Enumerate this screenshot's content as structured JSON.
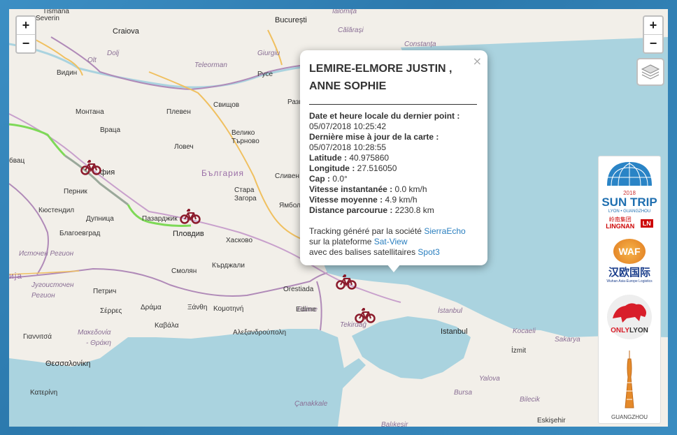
{
  "map": {
    "zoom_in_left": "+",
    "zoom_out_left": "−",
    "zoom_in_right": "+",
    "zoom_out_right": "−",
    "labels": [
      {
        "text": "Tismana",
        "cls": "lbl"
      },
      {
        "text": "Severin",
        "cls": "lbl"
      },
      {
        "text": "Craiova",
        "cls": "lbl city"
      },
      {
        "text": "Dolj",
        "cls": "lbl it"
      },
      {
        "text": "Olt",
        "cls": "lbl it"
      },
      {
        "text": "Teleorman",
        "cls": "lbl it"
      },
      {
        "text": "Ialomița",
        "cls": "lbl it"
      },
      {
        "text": "București",
        "cls": "lbl city"
      },
      {
        "text": "Călărași",
        "cls": "lbl it"
      },
      {
        "text": "Giurgiu",
        "cls": "lbl it"
      },
      {
        "text": "Călărași",
        "cls": "lbl"
      },
      {
        "text": "Constanța",
        "cls": "lbl it"
      },
      {
        "text": "Видин",
        "cls": "lbl"
      },
      {
        "text": "Русе",
        "cls": "lbl"
      },
      {
        "text": "Разгр",
        "cls": "lbl"
      },
      {
        "text": "Монтана",
        "cls": "lbl"
      },
      {
        "text": "Плевен",
        "cls": "lbl"
      },
      {
        "text": "Свищов",
        "cls": "lbl"
      },
      {
        "text": "Враца",
        "cls": "lbl"
      },
      {
        "text": "Велико",
        "cls": "lbl"
      },
      {
        "text": "Търново",
        "cls": "lbl"
      },
      {
        "text": "Ловеч",
        "cls": "lbl"
      },
      {
        "text": "бвац",
        "cls": "lbl"
      },
      {
        "text": "фия",
        "cls": "lbl city"
      },
      {
        "text": "България",
        "cls": "lbl country"
      },
      {
        "text": "Сливен",
        "cls": "lbl"
      },
      {
        "text": "Перник",
        "cls": "lbl"
      },
      {
        "text": "Стара",
        "cls": "lbl"
      },
      {
        "text": "Загора",
        "cls": "lbl"
      },
      {
        "text": "Ямбол",
        "cls": "lbl"
      },
      {
        "text": "Кюстендил",
        "cls": "lbl"
      },
      {
        "text": "Дупница",
        "cls": "lbl"
      },
      {
        "text": "Пазарджик",
        "cls": "lbl"
      },
      {
        "text": "Благоевград",
        "cls": "lbl"
      },
      {
        "text": "Пловдив",
        "cls": "lbl city"
      },
      {
        "text": "Хасково",
        "cls": "lbl"
      },
      {
        "text": "Источен Регион",
        "cls": "lbl it"
      },
      {
        "text": "Смолян",
        "cls": "lbl"
      },
      {
        "text": "Кърджали",
        "cls": "lbl"
      },
      {
        "text": "ија",
        "cls": "lbl country"
      },
      {
        "text": "Југоисточен",
        "cls": "lbl it"
      },
      {
        "text": "Регион",
        "cls": "lbl it"
      },
      {
        "text": "Петрич",
        "cls": "lbl"
      },
      {
        "text": "Σέρρες",
        "cls": "lbl"
      },
      {
        "text": "Δράμα",
        "cls": "lbl"
      },
      {
        "text": "Ξάνθη",
        "cls": "lbl"
      },
      {
        "text": "Κομοτηνή",
        "cls": "lbl"
      },
      {
        "text": "Orestiada",
        "cls": "lbl"
      },
      {
        "text": "Edirne",
        "cls": "lbl it"
      },
      {
        "text": "Μακεδονία",
        "cls": "lbl it"
      },
      {
        "text": "- Θράκη",
        "cls": "lbl it"
      },
      {
        "text": "Καβάλα",
        "cls": "lbl"
      },
      {
        "text": "Αλεξανδρούπολη",
        "cls": "lbl"
      },
      {
        "text": "Γιαννιτσά",
        "cls": "lbl"
      },
      {
        "text": "Θεσσαλονίκη",
        "cls": "lbl city"
      },
      {
        "text": "Κατερίνη",
        "cls": "lbl"
      },
      {
        "text": "Tekirdağ",
        "cls": "lbl it"
      },
      {
        "text": "İstanbul",
        "cls": "lbl it"
      },
      {
        "text": "Istanbul",
        "cls": "lbl city"
      },
      {
        "text": "Kocaeli",
        "cls": "lbl it"
      },
      {
        "text": "Sakarya",
        "cls": "lbl it"
      },
      {
        "text": "İzmit",
        "cls": "lbl"
      },
      {
        "text": "Yalova",
        "cls": "lbl it"
      },
      {
        "text": "Bursa",
        "cls": "lbl it"
      },
      {
        "text": "Bilecik",
        "cls": "lbl it"
      },
      {
        "text": "Çanakkale",
        "cls": "lbl it"
      },
      {
        "text": "Balıkesir",
        "cls": "lbl it"
      },
      {
        "text": "Eskişehir",
        "cls": "lbl"
      },
      {
        "text": "Edirne",
        "cls": "lbl"
      }
    ]
  },
  "popup": {
    "close": "×",
    "title": "LEMIRE-ELMORE JUSTIN , ANNE SOPHIE",
    "rows": [
      {
        "label": "Date et heure locale du dernier point :",
        "value": "05/07/2018 10:25:42",
        "newline": true
      },
      {
        "label": "Dernière mise à jour de la carte :",
        "value": "05/07/2018 10:28:55",
        "newline": true
      },
      {
        "label": "Latitude :",
        "value": "40.975860",
        "newline": false
      },
      {
        "label": "Longitude :",
        "value": "27.516050",
        "newline": false
      },
      {
        "label": "Cap :",
        "value": "0.0°",
        "newline": false
      },
      {
        "label": "Vitesse instantanée :",
        "value": "0.0 km/h",
        "newline": false
      },
      {
        "label": "Vitesse moyenne :",
        "value": "4.9 km/h",
        "newline": false
      },
      {
        "label": "Distance parcourue :",
        "value": "2230.8 km",
        "newline": false
      }
    ],
    "footer": [
      {
        "text": "Tracking généré par la société ",
        "link": "SierraEcho"
      },
      {
        "text": "sur la plateforme ",
        "link": "Sat-View"
      },
      {
        "text": "avec des balises satellitaires ",
        "link": "Spot3"
      }
    ]
  },
  "sponsors": {
    "suntrip_title": "SUN TRIP",
    "suntrip_year": "2018",
    "suntrip_sub": "LYON • GUANGZHOU",
    "lingnan": "LINGNAN",
    "lingnan_cn": "岭南集团",
    "ln": "LN",
    "waf": "WAF",
    "hanou": "汉欧国际",
    "hanou_sub": "Wuhan Asia-Europe Logistics",
    "onlylyon_only": "ONLY",
    "onlylyon_lyon": "LYON",
    "guangzhou": "GUANGZHOU"
  },
  "colors": {
    "sea": "#aad3df",
    "land": "#f2efe9",
    "border": "#b08ab8",
    "road": "#f0c060",
    "track_green": "#7ed957",
    "track_grey": "#9aa89a",
    "marker": "#8b1a2b",
    "link": "#2a7fbf"
  }
}
